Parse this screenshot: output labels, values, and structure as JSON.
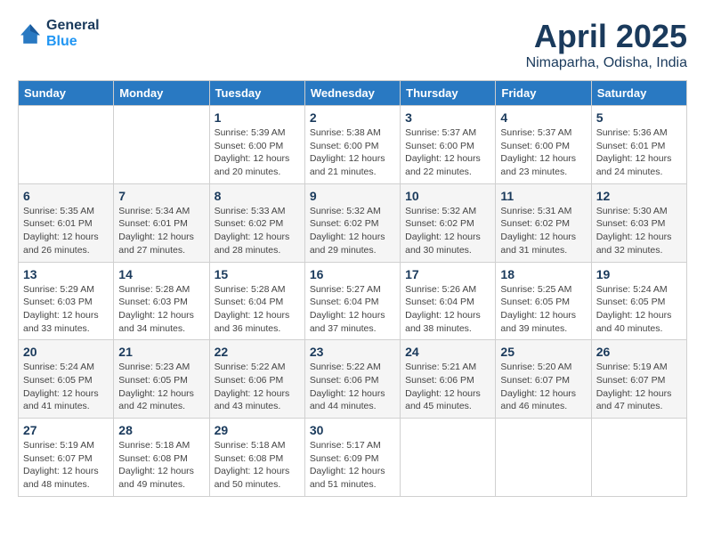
{
  "header": {
    "logo_line1": "General",
    "logo_line2": "Blue",
    "month": "April 2025",
    "location": "Nimaparha, Odisha, India"
  },
  "days_of_week": [
    "Sunday",
    "Monday",
    "Tuesday",
    "Wednesday",
    "Thursday",
    "Friday",
    "Saturday"
  ],
  "weeks": [
    [
      {
        "day": "",
        "info": ""
      },
      {
        "day": "",
        "info": ""
      },
      {
        "day": "1",
        "info": "Sunrise: 5:39 AM\nSunset: 6:00 PM\nDaylight: 12 hours\nand 20 minutes."
      },
      {
        "day": "2",
        "info": "Sunrise: 5:38 AM\nSunset: 6:00 PM\nDaylight: 12 hours\nand 21 minutes."
      },
      {
        "day": "3",
        "info": "Sunrise: 5:37 AM\nSunset: 6:00 PM\nDaylight: 12 hours\nand 22 minutes."
      },
      {
        "day": "4",
        "info": "Sunrise: 5:37 AM\nSunset: 6:00 PM\nDaylight: 12 hours\nand 23 minutes."
      },
      {
        "day": "5",
        "info": "Sunrise: 5:36 AM\nSunset: 6:01 PM\nDaylight: 12 hours\nand 24 minutes."
      }
    ],
    [
      {
        "day": "6",
        "info": "Sunrise: 5:35 AM\nSunset: 6:01 PM\nDaylight: 12 hours\nand 26 minutes."
      },
      {
        "day": "7",
        "info": "Sunrise: 5:34 AM\nSunset: 6:01 PM\nDaylight: 12 hours\nand 27 minutes."
      },
      {
        "day": "8",
        "info": "Sunrise: 5:33 AM\nSunset: 6:02 PM\nDaylight: 12 hours\nand 28 minutes."
      },
      {
        "day": "9",
        "info": "Sunrise: 5:32 AM\nSunset: 6:02 PM\nDaylight: 12 hours\nand 29 minutes."
      },
      {
        "day": "10",
        "info": "Sunrise: 5:32 AM\nSunset: 6:02 PM\nDaylight: 12 hours\nand 30 minutes."
      },
      {
        "day": "11",
        "info": "Sunrise: 5:31 AM\nSunset: 6:02 PM\nDaylight: 12 hours\nand 31 minutes."
      },
      {
        "day": "12",
        "info": "Sunrise: 5:30 AM\nSunset: 6:03 PM\nDaylight: 12 hours\nand 32 minutes."
      }
    ],
    [
      {
        "day": "13",
        "info": "Sunrise: 5:29 AM\nSunset: 6:03 PM\nDaylight: 12 hours\nand 33 minutes."
      },
      {
        "day": "14",
        "info": "Sunrise: 5:28 AM\nSunset: 6:03 PM\nDaylight: 12 hours\nand 34 minutes."
      },
      {
        "day": "15",
        "info": "Sunrise: 5:28 AM\nSunset: 6:04 PM\nDaylight: 12 hours\nand 36 minutes."
      },
      {
        "day": "16",
        "info": "Sunrise: 5:27 AM\nSunset: 6:04 PM\nDaylight: 12 hours\nand 37 minutes."
      },
      {
        "day": "17",
        "info": "Sunrise: 5:26 AM\nSunset: 6:04 PM\nDaylight: 12 hours\nand 38 minutes."
      },
      {
        "day": "18",
        "info": "Sunrise: 5:25 AM\nSunset: 6:05 PM\nDaylight: 12 hours\nand 39 minutes."
      },
      {
        "day": "19",
        "info": "Sunrise: 5:24 AM\nSunset: 6:05 PM\nDaylight: 12 hours\nand 40 minutes."
      }
    ],
    [
      {
        "day": "20",
        "info": "Sunrise: 5:24 AM\nSunset: 6:05 PM\nDaylight: 12 hours\nand 41 minutes."
      },
      {
        "day": "21",
        "info": "Sunrise: 5:23 AM\nSunset: 6:05 PM\nDaylight: 12 hours\nand 42 minutes."
      },
      {
        "day": "22",
        "info": "Sunrise: 5:22 AM\nSunset: 6:06 PM\nDaylight: 12 hours\nand 43 minutes."
      },
      {
        "day": "23",
        "info": "Sunrise: 5:22 AM\nSunset: 6:06 PM\nDaylight: 12 hours\nand 44 minutes."
      },
      {
        "day": "24",
        "info": "Sunrise: 5:21 AM\nSunset: 6:06 PM\nDaylight: 12 hours\nand 45 minutes."
      },
      {
        "day": "25",
        "info": "Sunrise: 5:20 AM\nSunset: 6:07 PM\nDaylight: 12 hours\nand 46 minutes."
      },
      {
        "day": "26",
        "info": "Sunrise: 5:19 AM\nSunset: 6:07 PM\nDaylight: 12 hours\nand 47 minutes."
      }
    ],
    [
      {
        "day": "27",
        "info": "Sunrise: 5:19 AM\nSunset: 6:07 PM\nDaylight: 12 hours\nand 48 minutes."
      },
      {
        "day": "28",
        "info": "Sunrise: 5:18 AM\nSunset: 6:08 PM\nDaylight: 12 hours\nand 49 minutes."
      },
      {
        "day": "29",
        "info": "Sunrise: 5:18 AM\nSunset: 6:08 PM\nDaylight: 12 hours\nand 50 minutes."
      },
      {
        "day": "30",
        "info": "Sunrise: 5:17 AM\nSunset: 6:09 PM\nDaylight: 12 hours\nand 51 minutes."
      },
      {
        "day": "",
        "info": ""
      },
      {
        "day": "",
        "info": ""
      },
      {
        "day": "",
        "info": ""
      }
    ]
  ]
}
